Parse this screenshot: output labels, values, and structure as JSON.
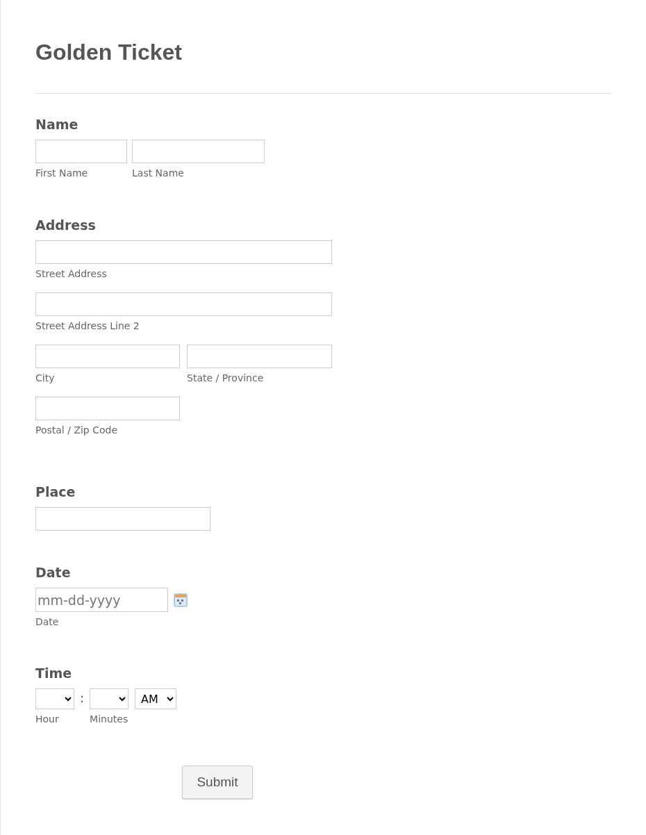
{
  "title": "Golden Ticket",
  "sections": [
    {
      "kind": "name",
      "label": "Name",
      "fields": [
        {
          "sublabel": "First Name"
        },
        {
          "sublabel": "Last Name"
        }
      ]
    },
    {
      "kind": "address",
      "label": "Address",
      "fields": [
        {
          "sublabel": "Street Address"
        },
        {
          "sublabel": "Street Address Line 2"
        },
        {
          "sublabel": "City"
        },
        {
          "sublabel": "State / Province"
        },
        {
          "sublabel": "Postal / Zip Code"
        }
      ]
    },
    {
      "kind": "place",
      "label": "Place"
    },
    {
      "kind": "date",
      "label": "Date",
      "placeholder": "mm-dd-yyyy",
      "sublabel": "Date"
    },
    {
      "kind": "time",
      "label": "Time",
      "separator": ":",
      "ampm": "AM",
      "fields": [
        {
          "sublabel": "Hour"
        },
        {
          "sublabel": "Minutes"
        }
      ]
    }
  ],
  "submit": "Submit"
}
